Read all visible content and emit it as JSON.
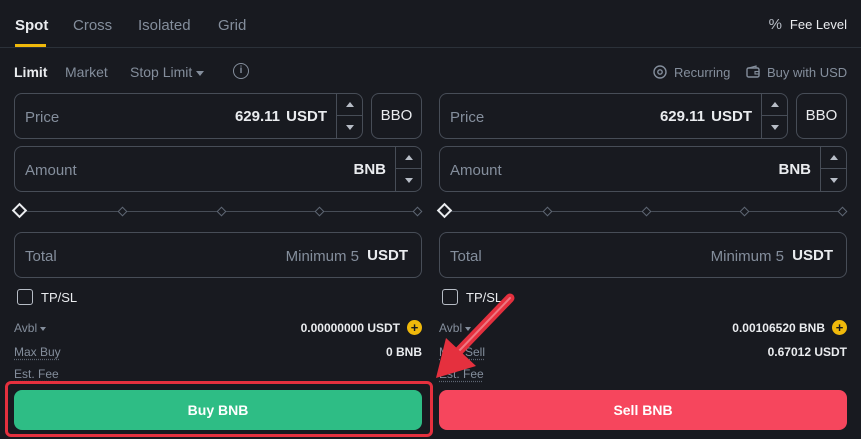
{
  "tabs": [
    {
      "label": "Spot",
      "active": true
    },
    {
      "label": "Cross",
      "active": false
    },
    {
      "label": "Isolated",
      "active": false
    },
    {
      "label": "Grid",
      "active": false
    }
  ],
  "fee_level": {
    "icon": "percent-icon",
    "label": "Fee Level"
  },
  "order_types": {
    "limit": "Limit",
    "market": "Market",
    "stop_limit": "Stop Limit",
    "info_glyph": "i"
  },
  "options": {
    "recurring": "Recurring",
    "buy_with_usd": "Buy with USD"
  },
  "buy": {
    "price_label": "Price",
    "price_value": "629.11",
    "price_unit": "USDT",
    "bbo_label": "BBO",
    "amount_label": "Amount",
    "amount_unit": "BNB",
    "total_label": "Total",
    "total_placeholder": "Minimum 5",
    "total_unit": "USDT",
    "tpsl_label": "TP/SL",
    "avbl_label": "Avbl",
    "avbl_value": "0.00000000 USDT",
    "max_label": "Max Buy",
    "max_value": "0 BNB",
    "fee_label": "Est. Fee",
    "button_label": "Buy BNB"
  },
  "sell": {
    "price_label": "Price",
    "price_value": "629.11",
    "price_unit": "USDT",
    "bbo_label": "BBO",
    "amount_label": "Amount",
    "amount_unit": "BNB",
    "total_label": "Total",
    "total_placeholder": "Minimum 5",
    "total_unit": "USDT",
    "tpsl_label": "TP/SL",
    "avbl_label": "Avbl",
    "avbl_value": "0.00106520 BNB",
    "max_label": "Max Sell",
    "max_value": "0.67012 USDT",
    "fee_label": "Est. Fee",
    "button_label": "Sell BNB"
  },
  "plus_glyph": "+",
  "colors": {
    "background": "#181a20",
    "accent": "#f0b90b",
    "buy": "#2ebd85",
    "sell": "#f6465d",
    "annotation": "#e5303e"
  }
}
